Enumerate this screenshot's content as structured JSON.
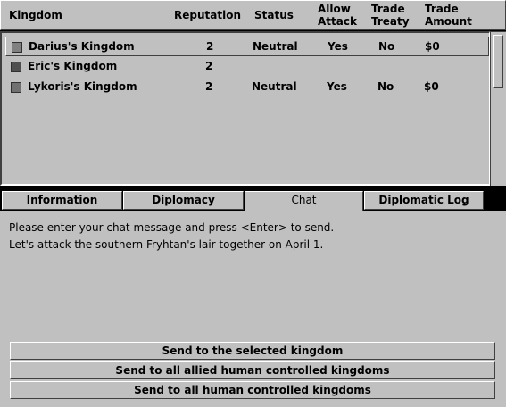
{
  "headers": {
    "kingdom": "Kingdom",
    "reputation": "Reputation",
    "status": "Status",
    "allow_attack_1": "Allow",
    "allow_attack_2": "Attack",
    "trade_treaty_1": "Trade",
    "trade_treaty_2": "Treaty",
    "trade_amount_1": "Trade",
    "trade_amount_2": "Amount"
  },
  "kingdoms": [
    {
      "name": "Darius's Kingdom",
      "reputation": "2",
      "status": "Neutral",
      "allow_attack": "Yes",
      "trade_treaty": "No",
      "trade_amount": "$0",
      "color": "#808080",
      "selected": true
    },
    {
      "name": "Eric's Kingdom",
      "reputation": "2",
      "status": "",
      "allow_attack": "",
      "trade_treaty": "",
      "trade_amount": "",
      "color": "#505050",
      "selected": false
    },
    {
      "name": "Lykoris's Kingdom",
      "reputation": "2",
      "status": "Neutral",
      "allow_attack": "Yes",
      "trade_treaty": "No",
      "trade_amount": "$0",
      "color": "#707070",
      "selected": false
    }
  ],
  "tabs": {
    "information": "Information",
    "diplomacy": "Diplomacy",
    "chat": "Chat",
    "diplomatic_log": "Diplomatic Log"
  },
  "chat": {
    "instruction": "Please enter your chat message and press <Enter> to send.",
    "message": "Let's attack the southern Fryhtan's lair together on April 1."
  },
  "buttons": {
    "send_selected": "Send to the selected kingdom",
    "send_allied": "Send to all allied human controlled kingdoms",
    "send_all": "Send to all human controlled kingdoms"
  },
  "colors": {
    "panel": "#c0c0c0",
    "frame": "#000000"
  }
}
